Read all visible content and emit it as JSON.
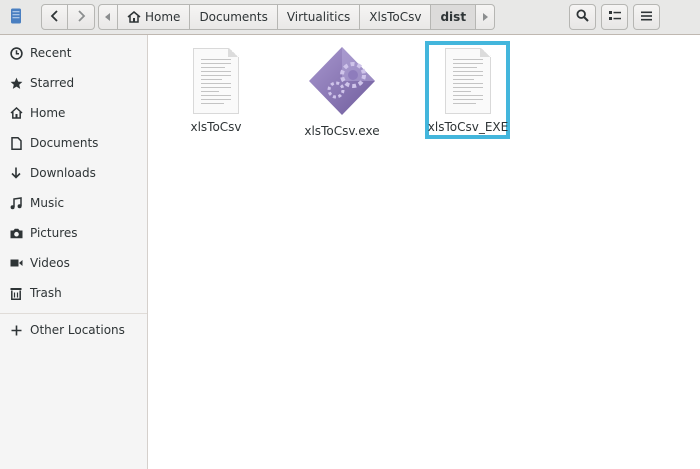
{
  "header": {
    "breadcrumbs": [
      "Home",
      "Documents",
      "Virtualitics",
      "XlsToCsv",
      "dist"
    ],
    "current": "dist"
  },
  "sidebar": {
    "items": [
      {
        "label": "Recent",
        "icon": "clock-icon"
      },
      {
        "label": "Starred",
        "icon": "star-icon"
      },
      {
        "label": "Home",
        "icon": "home-icon"
      },
      {
        "label": "Documents",
        "icon": "document-icon"
      },
      {
        "label": "Downloads",
        "icon": "download-icon"
      },
      {
        "label": "Music",
        "icon": "music-icon"
      },
      {
        "label": "Pictures",
        "icon": "camera-icon"
      },
      {
        "label": "Videos",
        "icon": "video-icon"
      },
      {
        "label": "Trash",
        "icon": "trash-icon"
      }
    ],
    "other_locations": {
      "label": "Other Locations",
      "icon": "plus-icon"
    }
  },
  "files": [
    {
      "name": "xlsToCsv",
      "icon": "text-file-icon"
    },
    {
      "name": "xlsToCsv.exe",
      "icon": "wine-executable-icon"
    },
    {
      "name": "xlsToCsv_EXE",
      "icon": "text-file-icon",
      "highlighted": true
    }
  ],
  "colors": {
    "highlight": "#43b6dc",
    "exe_icon": "#8c79b5"
  }
}
